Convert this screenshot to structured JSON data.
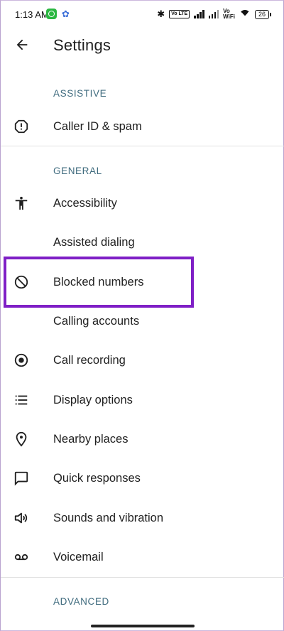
{
  "status_bar": {
    "time": "1:13 AM",
    "volte": "Vo LTE",
    "vowifi_top": "Vo",
    "vowifi_bottom": "WiFi",
    "battery": "26"
  },
  "app_bar": {
    "title": "Settings",
    "back_icon": "arrow-back-icon"
  },
  "sections": {
    "assistive": "ASSISTIVE",
    "general": "GENERAL",
    "advanced": "ADVANCED"
  },
  "items": [
    {
      "label": "Caller ID & spam",
      "icon": "alert-octagon-icon"
    },
    {
      "label": "Accessibility",
      "icon": "accessibility-icon"
    },
    {
      "label": "Assisted dialing",
      "icon": ""
    },
    {
      "label": "Blocked numbers",
      "icon": "block-icon"
    },
    {
      "label": "Calling accounts",
      "icon": ""
    },
    {
      "label": "Call recording",
      "icon": "record-icon"
    },
    {
      "label": "Display options",
      "icon": "list-icon"
    },
    {
      "label": "Nearby places",
      "icon": "location-pin-icon"
    },
    {
      "label": "Quick responses",
      "icon": "message-icon"
    },
    {
      "label": "Sounds and vibration",
      "icon": "volume-icon"
    },
    {
      "label": "Voicemail",
      "icon": "voicemail-icon"
    }
  ],
  "colors": {
    "section_header": "#3f6b7e",
    "highlight_border": "#7f1fc6",
    "divider": "#e0e0e0"
  }
}
